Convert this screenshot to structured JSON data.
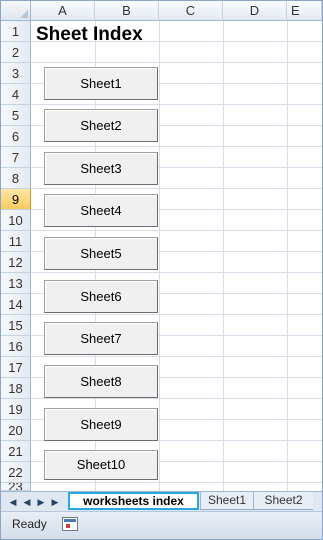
{
  "columns": [
    "A",
    "B",
    "C",
    "D",
    "E"
  ],
  "rows": [
    "1",
    "2",
    "3",
    "4",
    "5",
    "6",
    "7",
    "8",
    "9",
    "10",
    "11",
    "12",
    "13",
    "14",
    "15",
    "16",
    "17",
    "18",
    "19",
    "20",
    "21",
    "22",
    "23"
  ],
  "active_row": "9",
  "sheet_title": "Sheet Index",
  "buttons": [
    "Sheet1",
    "Sheet2",
    "Sheet3",
    "Sheet4",
    "Sheet5",
    "Sheet6",
    "Sheet7",
    "Sheet8",
    "Sheet9",
    "Sheet10"
  ],
  "tabs": {
    "active": "worksheets index",
    "others": [
      "Sheet1",
      "Sheet2"
    ]
  },
  "nav_icons": [
    "first-sheet-icon",
    "prev-sheet-icon",
    "next-sheet-icon",
    "last-sheet-icon"
  ],
  "status": {
    "text": "Ready",
    "icon": "macro-record-icon"
  }
}
